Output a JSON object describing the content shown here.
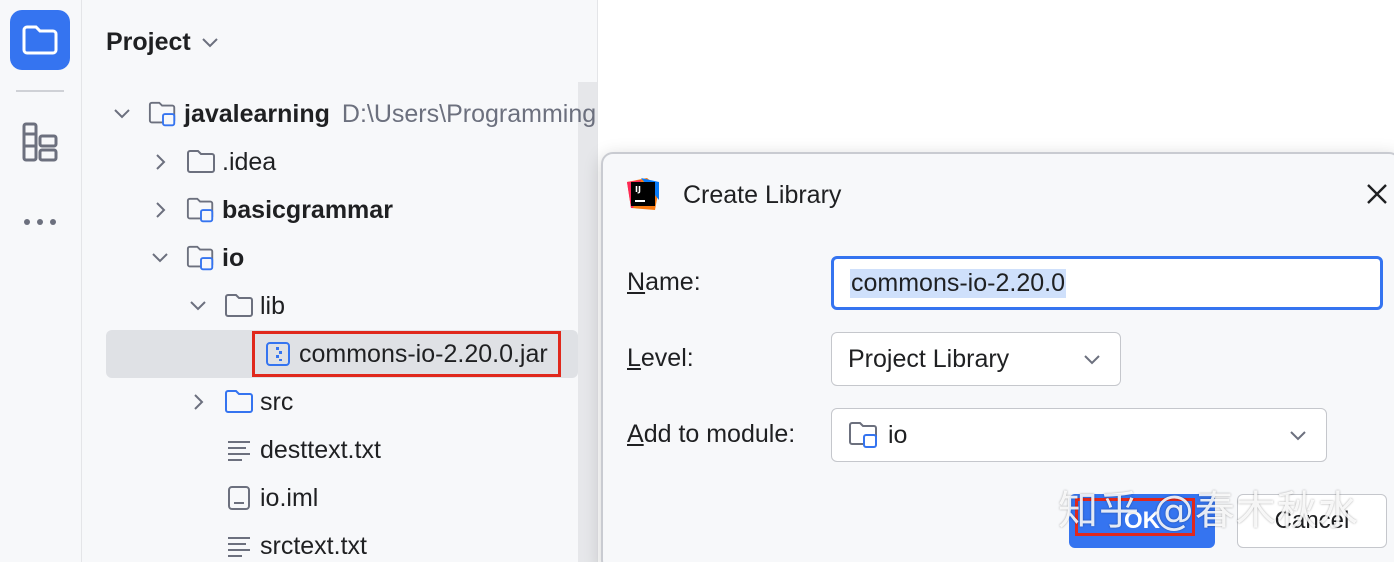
{
  "strip": {
    "icons": [
      "folder-icon",
      "structure-icon",
      "more-icon"
    ]
  },
  "panel": {
    "title": "Project"
  },
  "tree": {
    "root": {
      "label": "javalearning",
      "path": "D:\\Users\\Programming"
    },
    "idea": {
      "label": ".idea"
    },
    "basicgrammar": {
      "label": "basicgrammar"
    },
    "io": {
      "label": "io"
    },
    "lib": {
      "label": "lib"
    },
    "jar": {
      "label": "commons-io-2.20.0.jar"
    },
    "src": {
      "label": "src"
    },
    "desttext": {
      "label": "desttext.txt"
    },
    "ioiml": {
      "label": "io.iml"
    },
    "srctext": {
      "label": "srctext.txt"
    }
  },
  "dialog": {
    "title": "Create Library",
    "name_label_first": "N",
    "name_label_rest": "ame:",
    "name_value": "commons-io-2.20.0",
    "level_label_first": "L",
    "level_label_rest": "evel:",
    "level_value": "Project Library",
    "module_label_first": "A",
    "module_label_rest": "dd to module:",
    "module_value": "io",
    "ok_label": "OK",
    "cancel_label": "Cancel"
  },
  "watermark": "知乎 @春木秋水",
  "colors": {
    "accent": "#3574f0",
    "highlight_red": "#e0281c",
    "selection": "#dfe1e5"
  }
}
